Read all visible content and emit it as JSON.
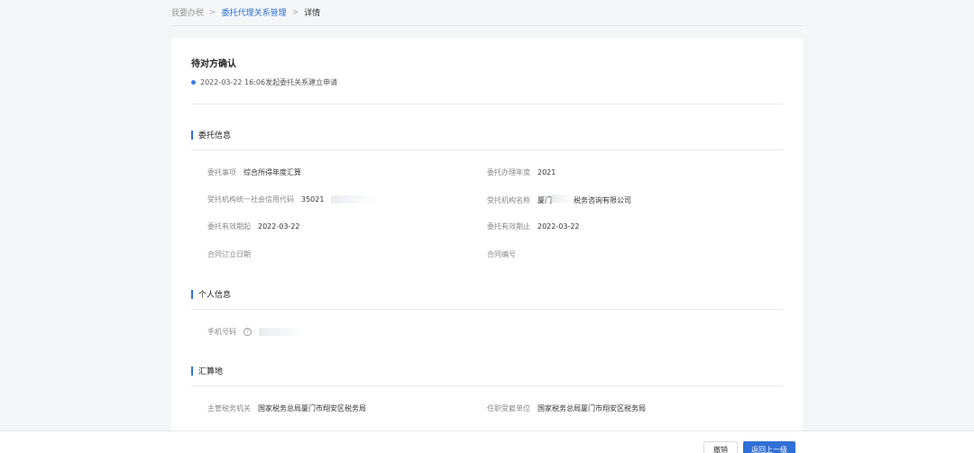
{
  "breadcrumb": {
    "home": "我要办税",
    "parent": "委托代理关系管理",
    "current": "详情",
    "separator": ">"
  },
  "status": {
    "title": "待对方确认",
    "event": "2022-03-22 16:06发起委托关系建立申请",
    "dot_color": "#3a7be0"
  },
  "sections": {
    "entrust": {
      "title": "委托信息",
      "item_label": "委托事项",
      "item_value": "综合所得年度汇算",
      "year_label": "委托办理年度",
      "year_value": "2021",
      "code_label": "受托机构统一社会信用代码",
      "code_value": "35021",
      "org_label": "受托机构名称",
      "org_value_prefix": "厦门",
      "org_value_suffix": "税务咨询有限公司",
      "start_label": "委托有效期起",
      "start_value": "2022-03-22",
      "end_label": "委托有效期止",
      "end_value": "2022-03-22",
      "contract_date_label": "合同订立日期",
      "contract_date_value": "",
      "contract_no_label": "合同编号",
      "contract_no_value": ""
    },
    "personal": {
      "title": "个人信息",
      "phone_label": "手机号码",
      "help_icon": "?"
    },
    "settlement": {
      "title": "汇算地",
      "tax_office_label": "主管税务机关",
      "tax_office_value": "国家税务总局厦门市翔安区税务局",
      "receiver_label": "任职受雇单位",
      "receiver_value": "国家税务总局厦门市翔安区税务局"
    }
  },
  "footer": {
    "cancel_label": "撤销",
    "back_label": "返回上一级"
  },
  "colors": {
    "accent": "#2f6fd6",
    "background": "#f5f6f8"
  }
}
